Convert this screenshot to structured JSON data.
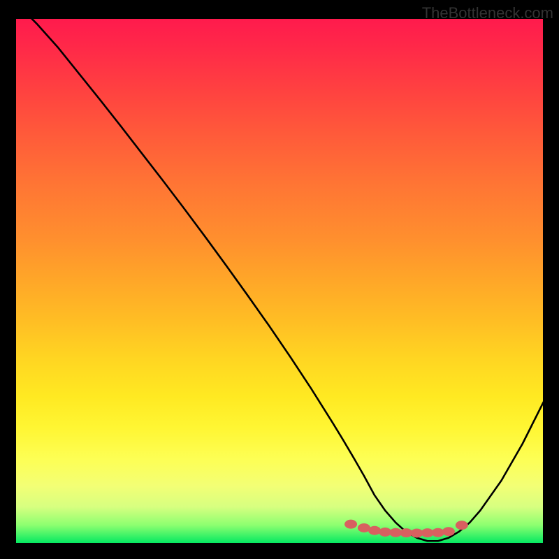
{
  "watermark": "TheBottleneck.com",
  "chart_data": {
    "type": "line",
    "title": "",
    "xlabel": "",
    "ylabel": "",
    "xlim": [
      0,
      100
    ],
    "ylim": [
      0,
      100
    ],
    "series": [
      {
        "name": "curve",
        "x": [
          0,
          4,
          8,
          12,
          16,
          20,
          24,
          28,
          32,
          36,
          40,
          44,
          48,
          52,
          56,
          60,
          62,
          64,
          66,
          68,
          70,
          72,
          74,
          76,
          78,
          80,
          82,
          84,
          86,
          88,
          92,
          96,
          100
        ],
        "y": [
          103,
          99,
          94.5,
          89.5,
          84.5,
          79.4,
          74.2,
          69,
          63.7,
          58.3,
          52.8,
          47.2,
          41.5,
          35.6,
          29.5,
          23.1,
          19.8,
          16.4,
          12.9,
          9.2,
          6.3,
          4.0,
          2.2,
          1.1,
          0.5,
          0.5,
          1.1,
          2.3,
          4.0,
          6.3,
          12.0,
          19.0,
          27.0
        ]
      },
      {
        "name": "highlight-dots",
        "x": [
          63.5,
          66.0,
          68.0,
          70.0,
          72.0,
          74.0,
          76.0,
          78.0,
          80.0,
          82.0,
          84.5
        ],
        "y": [
          3.7,
          3.0,
          2.5,
          2.2,
          2.1,
          2.05,
          2.0,
          2.05,
          2.1,
          2.3,
          3.5
        ]
      }
    ],
    "colors": {
      "curve": "#000000",
      "dots": "#d86060"
    }
  }
}
